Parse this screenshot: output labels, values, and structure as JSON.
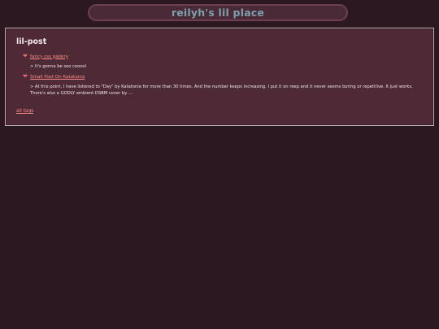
{
  "site": {
    "title": "reilyh's lil place"
  },
  "tag_page": {
    "title": "lil-post",
    "posts": [
      {
        "icon": "heart-icon",
        "title": "fancy css gallery",
        "excerpt": "> It's gonna be soo cooool"
      },
      {
        "icon": "heart-icon",
        "title": "Small Post On Katatonia",
        "excerpt": "> At this point, I have listened to \"Day\" by Katatonia for more than 30 times. And the number keeps increasing. I put it on reep and it never seems boring or repetitive. It just works. There's also a GODLY ambient DSBM cover by ..."
      }
    ],
    "all_tags_label": "all tags"
  },
  "colors": {
    "background": "#2b1820",
    "panel": "#4d2a35",
    "header_pill": "#4a2a37",
    "title_text": "#7da0ad",
    "link": "#ff8c87",
    "heart": "#e06470"
  }
}
